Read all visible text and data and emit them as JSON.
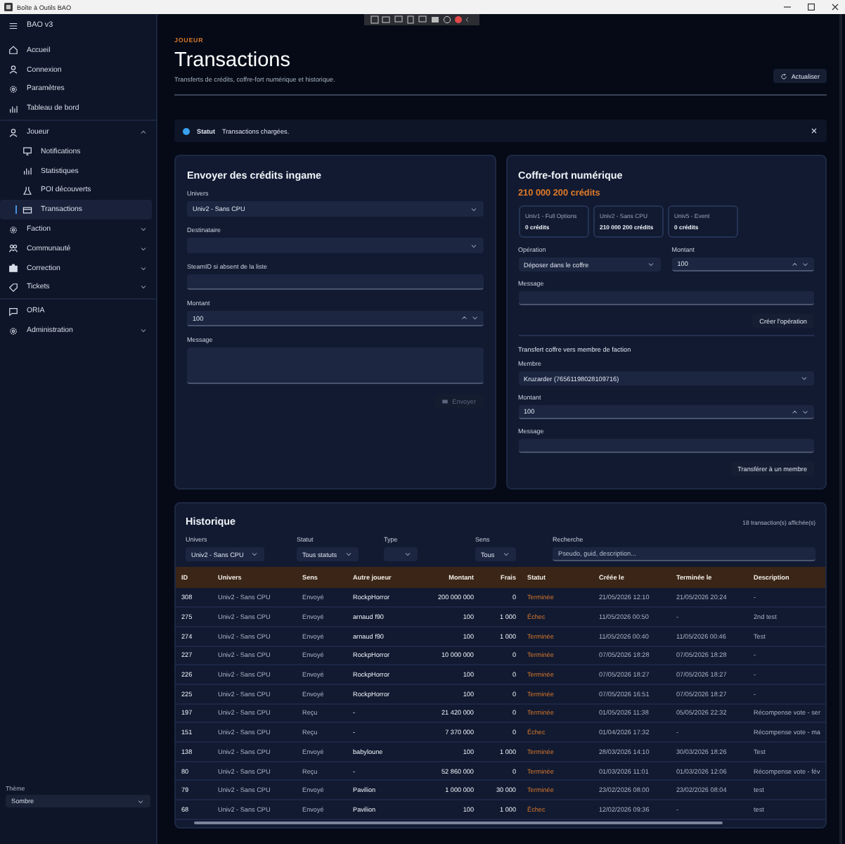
{
  "window": {
    "title": "Boîte à Outils BAO"
  },
  "sidebar": {
    "app_name": "BAO v3",
    "sections": [
      [
        {
          "label": "Accueil"
        },
        {
          "label": "Connexion"
        },
        {
          "label": "Paramètres"
        },
        {
          "label": "Tableau de bord"
        }
      ],
      [
        {
          "label": "Joueur",
          "expanded": true,
          "children": [
            {
              "label": "Notifications",
              "selected": false
            },
            {
              "label": "Statistiques",
              "selected": false
            },
            {
              "label": "POI découverts",
              "selected": false
            },
            {
              "label": "Transactions",
              "selected": true
            }
          ]
        },
        {
          "label": "Faction",
          "expanded": false
        },
        {
          "label": "Communauté",
          "expanded": false
        },
        {
          "label": "Correction",
          "expanded": false
        },
        {
          "label": "Tickets",
          "expanded": false
        }
      ],
      [
        {
          "label": "ORIA"
        },
        {
          "label": "Administration",
          "expanded": false
        }
      ]
    ],
    "theme_label": "Thème",
    "theme_value": "Sombre"
  },
  "page": {
    "eyebrow": "JOUEUR",
    "title": "Transactions",
    "subtitle": "Transferts de crédits, coffre-fort numérique et historique.",
    "refresh_button": "Actualiser"
  },
  "status": {
    "label": "Statut",
    "message": "Transactions chargées."
  },
  "send_form": {
    "title": "Envoyer des crédits ingame",
    "rows": [
      [
        {
          "kind": "select",
          "label": "Univers",
          "value": "Univ2 - Sans CPU"
        }
      ],
      [
        {
          "kind": "select",
          "label": "Destinataire"
        }
      ],
      [
        {
          "kind": "text",
          "label": "SteamID si absent de la liste"
        }
      ],
      [
        {
          "kind": "number",
          "label": "Montant",
          "value": "100"
        }
      ],
      [
        {
          "kind": "textarea",
          "label": "Message"
        }
      ]
    ],
    "button": {
      "label": "Envoyer",
      "disabled": true
    }
  },
  "vault": {
    "title": "Coffre-fort numérique",
    "balance": "210 000 200 crédits",
    "universes": [
      {
        "name": "Univ1 - Full Options",
        "credits": "0 crédits"
      },
      {
        "name": "Univ2 - Sans CPU",
        "credits": "210 000 200 crédits"
      },
      {
        "name": "Univ5 - Event",
        "credits": "0 crédits"
      }
    ],
    "rows": [
      [
        {
          "kind": "select",
          "label": "Opération",
          "value": "Déposer dans le coffre"
        },
        {
          "kind": "number",
          "label": "Montant",
          "value": "100"
        }
      ],
      [
        {
          "kind": "text",
          "label": "Message"
        }
      ]
    ],
    "button": {
      "label": "Créer l'opération",
      "disabled": false
    },
    "transfer_title": "Transfert coffre vers membre de faction",
    "transfer_rows": [
      [
        {
          "kind": "select",
          "label": "Membre",
          "value": "Kruzarder (76561198028109716)"
        }
      ],
      [
        {
          "kind": "number",
          "label": "Montant",
          "value": "100"
        }
      ],
      [
        {
          "kind": "text",
          "label": "Message"
        }
      ]
    ],
    "transfer_button": {
      "label": "Transférer à un membre",
      "disabled": false
    }
  },
  "history": {
    "title": "Historique",
    "count": "18 transaction(s) affichée(s)",
    "filters": [
      {
        "kind": "select",
        "label": "Univers",
        "value": "Univ2 - Sans CPU"
      },
      {
        "kind": "select",
        "label": "Statut",
        "value": "Tous statuts"
      },
      {
        "kind": "select",
        "label": "Type"
      },
      {
        "kind": "select",
        "label": "Sens",
        "value": "Tous"
      },
      {
        "kind": "search",
        "label": "Recherche",
        "placeholder": "Pseudo, guid, description..."
      }
    ],
    "table": {
      "columns": [
        "ID",
        "Univers",
        "Sens",
        "Autre joueur",
        "Montant",
        "Frais",
        "Statut",
        "Créée le",
        "Terminée le",
        "Description"
      ],
      "rows": [
        [
          "308",
          "Univ2 - Sans CPU",
          "Envoyé",
          "RockpHorror",
          "200 000 000",
          "0",
          "Terminée",
          "21/05/2026 12:10",
          "21/05/2026 20:24",
          "-"
        ],
        [
          "275",
          "Univ2 - Sans CPU",
          "Envoyé",
          "arnaud f90",
          "100",
          "1 000",
          "Échec",
          "11/05/2026 00:50",
          "-",
          "2nd test"
        ],
        [
          "274",
          "Univ2 - Sans CPU",
          "Envoyé",
          "arnaud f90",
          "100",
          "1 000",
          "Terminée",
          "11/05/2026 00:40",
          "11/05/2026 00:46",
          "Test"
        ],
        [
          "227",
          "Univ2 - Sans CPU",
          "Envoyé",
          "RockpHorror",
          "10 000 000",
          "0",
          "Terminée",
          "07/05/2026 18:28",
          "07/05/2026 18:28",
          "-"
        ],
        [
          "226",
          "Univ2 - Sans CPU",
          "Envoyé",
          "RockpHorror",
          "100",
          "0",
          "Terminée",
          "07/05/2026 18:27",
          "07/05/2026 18:27",
          "-"
        ],
        [
          "225",
          "Univ2 - Sans CPU",
          "Envoyé",
          "RockpHorror",
          "100",
          "0",
          "Terminée",
          "07/05/2026 16:51",
          "07/05/2026 18:27",
          "-"
        ],
        [
          "197",
          "Univ2 - Sans CPU",
          "Reçu",
          "-",
          "21 420 000",
          "0",
          "Terminée",
          "01/05/2026 11:38",
          "05/05/2026 22:32",
          "Récompense vote - ser"
        ],
        [
          "151",
          "Univ2 - Sans CPU",
          "Reçu",
          "-",
          "7 370 000",
          "0",
          "Échec",
          "01/04/2026 17:32",
          "-",
          "Récompense vote - ma"
        ],
        [
          "138",
          "Univ2 - Sans CPU",
          "Envoyé",
          "babyloune",
          "100",
          "1 000",
          "Terminée",
          "28/03/2026 14:10",
          "30/03/2026 18:26",
          "Test"
        ],
        [
          "80",
          "Univ2 - Sans CPU",
          "Reçu",
          "-",
          "52 860 000",
          "0",
          "Terminée",
          "01/03/2026 11:01",
          "01/03/2026 12:06",
          "Récompense vote - fév"
        ],
        [
          "79",
          "Univ2 - Sans CPU",
          "Envoyé",
          "Pavilion",
          "1 000 000",
          "30 000",
          "Terminée",
          "23/02/2026 08:00",
          "23/02/2026 08:04",
          "test"
        ],
        [
          "68",
          "Univ2 - Sans CPU",
          "Envoyé",
          "Pavilion",
          "100",
          "1 000",
          "Échec",
          "12/02/2026 09:36",
          "-",
          "test"
        ]
      ]
    }
  }
}
